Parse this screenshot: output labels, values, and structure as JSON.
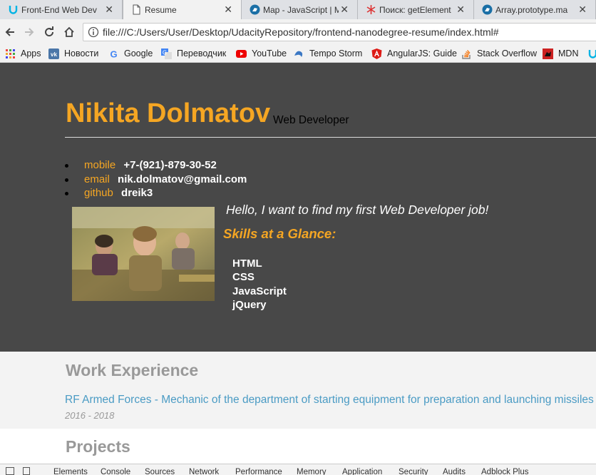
{
  "browser": {
    "tabs": [
      {
        "title": "Front-End Web Dev",
        "icon": "udacity-icon"
      },
      {
        "title": "Resume",
        "icon": "document-icon"
      },
      {
        "title": "Map - JavaScript | M",
        "icon": "mdn-dino-icon"
      },
      {
        "title": "Поиск: getElement",
        "icon": "search-icon"
      },
      {
        "title": "Array.prototype.ma",
        "icon": "mdn-dino-icon"
      }
    ],
    "url": "file:///C:/Users/User/Desktop/UdacityRepository/frontend-nanodegree-resume/index.html#",
    "bookmarks": [
      {
        "label": "Apps",
        "icon": "apps-grid-icon"
      },
      {
        "label": "Новости",
        "icon": "vk-icon"
      },
      {
        "label": "Google",
        "icon": "google-icon"
      },
      {
        "label": "Переводчик",
        "icon": "translate-icon"
      },
      {
        "label": "YouTube",
        "icon": "youtube-icon"
      },
      {
        "label": "Tempo Storm",
        "icon": "tempo-storm-icon"
      },
      {
        "label": "AngularJS: Guide",
        "icon": "angular-icon"
      },
      {
        "label": "Stack Overflow",
        "icon": "stackoverflow-icon"
      },
      {
        "label": "MDN",
        "icon": "mdn-icon"
      }
    ]
  },
  "resume": {
    "name": "Nikita Dolmatov",
    "role": "Web Developer",
    "contacts": [
      {
        "key": "mobile",
        "value": "+7-(921)-879-30-52"
      },
      {
        "key": "email",
        "value": "nik.dolmatov@gmail.com"
      },
      {
        "key": "github",
        "value": "dreik3"
      }
    ],
    "welcome": "Hello, I want to find my first Web Developer job!",
    "skills_heading": "Skills at a Glance:",
    "skills": [
      "HTML",
      "CSS",
      "JavaScript",
      "jQuery"
    ],
    "work_heading": "Work Experience",
    "work": {
      "title": "RF Armed Forces - Mechanic of the department of starting equipment for preparation and launching missiles",
      "dates": "2016 - 2018"
    },
    "projects_heading": "Projects"
  },
  "devtools": {
    "tabs": [
      "Elements",
      "Console",
      "Sources",
      "Network",
      "Performance",
      "Memory",
      "Application",
      "Security",
      "Audits",
      "Adblock Plus"
    ]
  },
  "colors": {
    "accent": "#f5a623",
    "header_bg": "#484848",
    "link": "#4a9bc4",
    "heading_gray": "#999999"
  }
}
